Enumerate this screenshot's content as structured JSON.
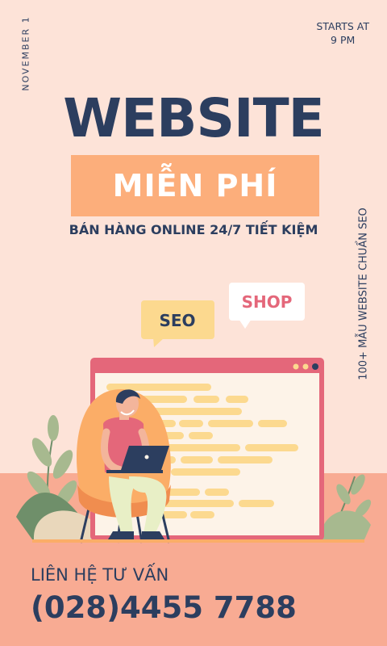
{
  "date": "NOVEMBER 1",
  "starts": {
    "line1": "STARTS AT",
    "line2": "9 PM"
  },
  "side_text": "100+ MẪU WEBSITE CHUẨN SEO",
  "title": "WEBSITE",
  "banner": "MIỄN PHÍ",
  "subtitle": "BÁN HÀNG ONLINE 24/7 TIẾT KIỆM",
  "bubbles": {
    "seo": "SEO",
    "shop": "SHOP"
  },
  "contact": {
    "label": "LIÊN HỆ TƯ VẤN",
    "phone": "(028)4455 7788"
  },
  "colors": {
    "background": "#fde3d8",
    "floor": "#f8ab93",
    "navy": "#2c3e5f",
    "orange": "#fcae7b",
    "window_frame": "#e4677a",
    "code_lines": "#fcd98f",
    "seo_bubble": "#fcd98f",
    "shop_text": "#e4677a"
  }
}
